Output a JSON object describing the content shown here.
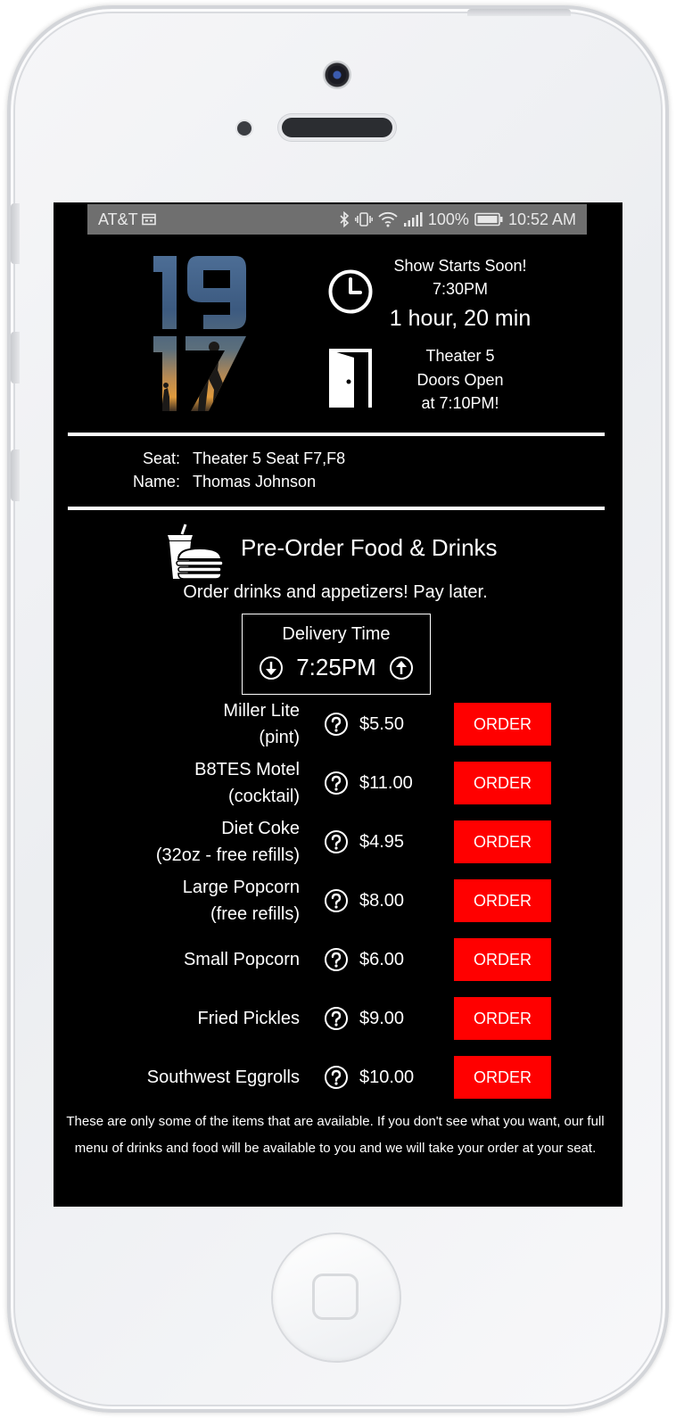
{
  "status_bar": {
    "carrier": "AT&T",
    "battery": "100%",
    "time": "10:52 AM"
  },
  "poster": {
    "title_top": "19",
    "title_bottom": "17"
  },
  "show": {
    "title": "Show Starts Soon!",
    "time": "7:30PM",
    "countdown": "1 hour, 20 min"
  },
  "theater": {
    "line1": "Theater 5",
    "line2": "Doors Open",
    "line3": "at 7:10PM!"
  },
  "ticket": {
    "seat_label": "Seat:",
    "seat_value": "Theater 5 Seat F7,F8",
    "name_label": "Name:",
    "name_value": "Thomas Johnson"
  },
  "preorder": {
    "title": "Pre-Order Food & Drinks",
    "subtitle": "Order drinks and appetizers! Pay later."
  },
  "delivery": {
    "label": "Delivery Time",
    "time": "7:25PM"
  },
  "menu": [
    {
      "name": "Miller Lite",
      "detail": "(pint)",
      "price": "$5.50",
      "button": "ORDER"
    },
    {
      "name": "B8TES Motel",
      "detail": "(cocktail)",
      "price": "$11.00",
      "button": "ORDER"
    },
    {
      "name": "Diet Coke",
      "detail": "(32oz - free refills)",
      "price": "$4.95",
      "button": "ORDER"
    },
    {
      "name": "Large Popcorn",
      "detail": "(free refills)",
      "price": "$8.00",
      "button": "ORDER"
    },
    {
      "name": "Small Popcorn",
      "detail": "",
      "price": "$6.00",
      "button": "ORDER"
    },
    {
      "name": "Fried Pickles",
      "detail": "",
      "price": "$9.00",
      "button": "ORDER"
    },
    {
      "name": "Southwest Eggrolls",
      "detail": "",
      "price": "$10.00",
      "button": "ORDER"
    }
  ],
  "footer": {
    "note": "These are only some of the items that are available. If you don't see what you want, our full menu of drinks and food will be available to you and we will take your order at your seat."
  },
  "colors": {
    "order_button": "#ff0000",
    "screen_bg": "#000000",
    "status_bar_bg": "#6f6f6f"
  },
  "icons": [
    "calendar-icon",
    "bluetooth-icon",
    "vibrate-icon",
    "wifi-icon",
    "signal-icon",
    "battery-icon",
    "clock-icon",
    "door-icon",
    "food-drink-icon",
    "arrow-down-circle-icon",
    "arrow-up-circle-icon",
    "question-circle-icon"
  ]
}
